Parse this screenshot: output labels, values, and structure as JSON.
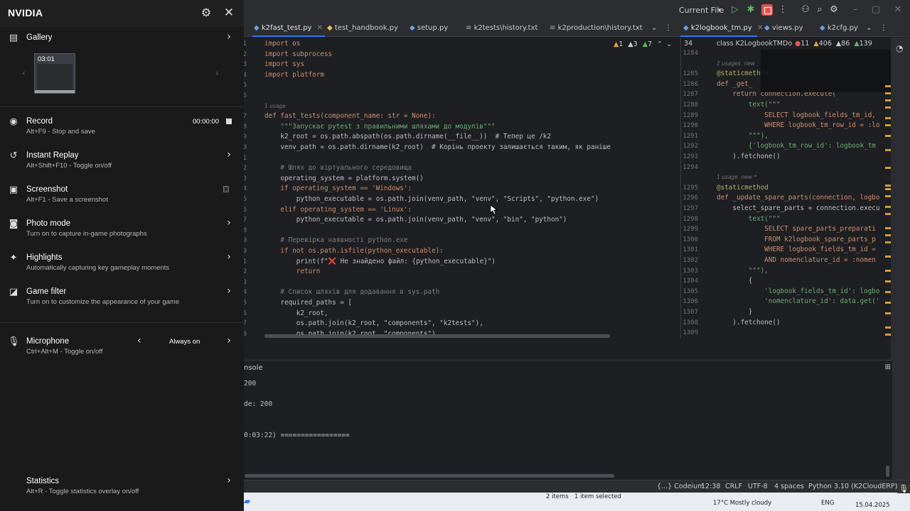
{
  "ide": {
    "titlebar": {
      "run_config": "Current File",
      "icons": [
        "run-icon",
        "debug-icon",
        "stop-icon",
        "more-icon",
        "add-user-icon",
        "search-icon",
        "settings-icon"
      ]
    },
    "tabs_left": [
      {
        "label": "k2fast_test.py",
        "active": true
      },
      {
        "label": "test_handbook.py",
        "active": false
      },
      {
        "label": "setup.py",
        "active": false
      },
      {
        "label": "k2tests\\history.txt",
        "active": false
      },
      {
        "label": "k2production\\history.txt",
        "active": false
      }
    ],
    "tabs_right": [
      {
        "label": "k2logbook_tm.py",
        "active": true
      },
      {
        "label": "views.py",
        "active": false
      },
      {
        "label": "k2cfg.py",
        "active": false
      }
    ],
    "left_inspect": {
      "warnings": "1",
      "weak_warnings": "3",
      "typos": "7"
    },
    "right_inspect": {
      "errors": "11",
      "warnings": "406",
      "weak": "86",
      "typos": "139"
    },
    "right_breadcrumb": "class K2LogbookTMDo",
    "left_code": [
      {
        "n": "1",
        "text": "import os"
      },
      {
        "n": "2",
        "text": "import subprocess"
      },
      {
        "n": "3",
        "text": "import sys"
      },
      {
        "n": "4",
        "text": "import platform"
      },
      {
        "n": "5",
        "text": ""
      },
      {
        "n": "6",
        "text": ""
      },
      {
        "n": "",
        "text": "1 usage"
      },
      {
        "n": "7",
        "text": "def fast_tests(component_name: str = None):"
      },
      {
        "n": "8",
        "text": "    \"\"\"Запускає pytest з правильними шляхами до модулів\"\"\""
      },
      {
        "n": "9",
        "text": "    k2_root = os.path.abspath(os.path.dirname(__file__))  # Тепер це /k2"
      },
      {
        "n": "10",
        "text": "    venv_path = os.path.dirname(k2_root)  # Корінь проекту залишається таким, як раніше"
      },
      {
        "n": "11",
        "text": ""
      },
      {
        "n": "12",
        "text": "    # Шлях до віртуального середовища"
      },
      {
        "n": "13",
        "text": "    operating_system = platform.system()"
      },
      {
        "n": "14",
        "text": "    if operating_system == 'Windows':"
      },
      {
        "n": "15",
        "text": "        python_executable = os.path.join(venv_path, \"venv\", \"Scripts\", \"python.exe\")"
      },
      {
        "n": "16",
        "text": "    elif operating_system == 'Linux':"
      },
      {
        "n": "17",
        "text": "        python_executable = os.path.join(venv_path, \"venv\", \"bin\", \"python\")"
      },
      {
        "n": "18",
        "text": ""
      },
      {
        "n": "19",
        "text": "    # Перевірка наявності python.exe"
      },
      {
        "n": "20",
        "text": "    if not os.path.isfile(python_executable):"
      },
      {
        "n": "21",
        "text": "        print(f\"❌ Не знайдено файл: {python_executable}\")"
      },
      {
        "n": "22",
        "text": "        return"
      },
      {
        "n": "23",
        "text": ""
      },
      {
        "n": "24",
        "text": "    # Список шляхів для додавання в sys.path"
      },
      {
        "n": "25",
        "text": "    required_paths = ["
      },
      {
        "n": "26",
        "text": "        k2_root,"
      },
      {
        "n": "27",
        "text": "        os.path.join(k2_root, \"components\", \"k2tests\"),"
      },
      {
        "n": "28",
        "text": "        os.path.join(k2_root, \"components\"),"
      }
    ],
    "right_code": [
      {
        "n": "1284",
        "text": ""
      },
      {
        "n": "",
        "text": "2 usages  new"
      },
      {
        "n": "1285",
        "text": "@staticmethod"
      },
      {
        "n": "1286",
        "text": "def _get_"
      },
      {
        "n": "1287",
        "text": "    return connection.execute("
      },
      {
        "n": "1288",
        "text": "        text(\"\"\""
      },
      {
        "n": "1289",
        "text": "            SELECT logbook_fields_tm_id,"
      },
      {
        "n": "1290",
        "text": "            WHERE logbook_tm_row_id = :lo"
      },
      {
        "n": "1291",
        "text": "        \"\"\"),"
      },
      {
        "n": "1292",
        "text": "        {'logbook_tm_row_id': logbook_tm"
      },
      {
        "n": "1293",
        "text": "    ).fetchone()"
      },
      {
        "n": "1294",
        "text": ""
      },
      {
        "n": "",
        "text": "1 usage  new *"
      },
      {
        "n": "1295",
        "text": "@staticmethod"
      },
      {
        "n": "1296",
        "text": "def _update_spare_parts(connection, logbo"
      },
      {
        "n": "1297",
        "text": "    select_spare_parts = connection.execu"
      },
      {
        "n": "1298",
        "text": "        text(\"\"\""
      },
      {
        "n": "1299",
        "text": "            SELECT spare_parts_preparati"
      },
      {
        "n": "1300",
        "text": "            FROM k2logbook_spare_parts_p"
      },
      {
        "n": "1301",
        "text": "            WHERE logbook_fields_tm_id ="
      },
      {
        "n": "1302",
        "text": "            AND nomenclature_id = :nomen"
      },
      {
        "n": "1303",
        "text": "        \"\"\"),"
      },
      {
        "n": "1304",
        "text": "        {"
      },
      {
        "n": "1305",
        "text": "            'logbook_fields_tm_id': logbo"
      },
      {
        "n": "1306",
        "text": "            'nomenclature_id': data.get('"
      },
      {
        "n": "1307",
        "text": "        }"
      },
      {
        "n": "1308",
        "text": "    ).fetchone()"
      },
      {
        "n": "1309",
        "text": ""
      }
    ],
    "console": {
      "tab_label": "nsole",
      "lines": [
        "200",
        "",
        "de: 200",
        "",
        "0:03:22) ================="
      ]
    },
    "statusbar": {
      "codeium": "{...} Codeium",
      "position": "12:38",
      "line_sep": "CRLF",
      "encoding": "UTF-8",
      "indent": "4 spaces",
      "interpreter": "Python 3.10 (K2CloudERP)"
    },
    "taskbar": {
      "items_count": "2 items",
      "selected": "1 item selected",
      "weather": "17°C  Mostly cloudy",
      "lang": "ENG",
      "date": "15.04.2025"
    }
  },
  "overlay": {
    "brand": "NVIDIA",
    "gallery": {
      "title": "Gallery",
      "thumb_time": "03:01"
    },
    "record": {
      "title": "Record",
      "sub": "Alt+F9 - Stop and save",
      "time": "00:00:00"
    },
    "instant_replay": {
      "title": "Instant Replay",
      "sub": "Alt+Shift+F10 - Toggle on/off"
    },
    "screenshot": {
      "title": "Screenshot",
      "sub": "Alt+F1 - Save a screenshot"
    },
    "photo_mode": {
      "title": "Photo mode",
      "sub": "Turn on to capture in-game photographs"
    },
    "highlights": {
      "title": "Highlights",
      "sub": "Automatically capturing key gameplay moments"
    },
    "game_filter": {
      "title": "Game filter",
      "sub": "Turn on to customize the appearance of your game"
    },
    "microphone": {
      "title": "Microphone",
      "sub": "Ctrl+Alt+M - Toggle on/off",
      "mode": "Always on"
    },
    "statistics": {
      "title": "Statistics",
      "sub": "Alt+R - Toggle statistics overlay on/off"
    }
  },
  "colors": {
    "accent": "#3574f0",
    "nvidia_bg": "#1a1a1a",
    "editor_bg": "#1e1f22"
  }
}
